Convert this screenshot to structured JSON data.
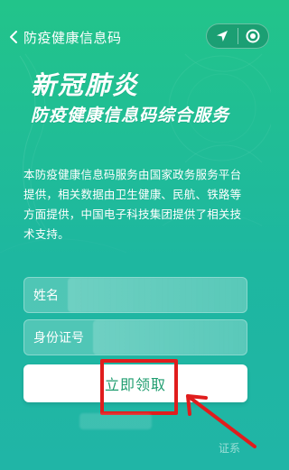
{
  "nav": {
    "title": "防疫健康信息码",
    "back_icon": "chevron-left-icon",
    "capsule_icons": [
      "location-arrow-icon",
      "record-target-icon"
    ]
  },
  "hero": {
    "title_line1": "新冠肺炎",
    "title_line2": "防疫健康信息码综合服务"
  },
  "description": "本防疫健康信息码服务由国家政务服务平台提供，相关数据由卫生健康、民航、铁路等方面提供，中国电子科技集团提供了相关技术支持。",
  "form": {
    "name_label": "姓名",
    "id_label": "身份证号",
    "submit_label": "立即领取"
  },
  "footer": {
    "right_text": "证系"
  },
  "colors": {
    "brand_green": "#1f9d6f",
    "highlight_red": "#e01d1d"
  }
}
